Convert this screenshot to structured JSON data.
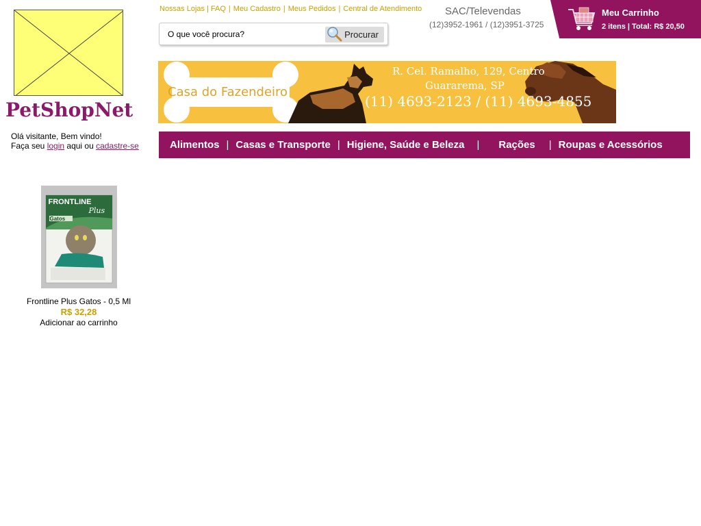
{
  "logo": {
    "text": "PetShopNet"
  },
  "greeting": {
    "line1": "Olá visitante, Bem vindo!",
    "line2_prefix": "Faça seu",
    "login_link": "login",
    "line2_middle": "aqui ou",
    "signup_link": "cadastre-se"
  },
  "top_links": [
    "Nossas Lojas",
    "FAQ",
    "Meu Cadastro",
    "Meus Pedidos",
    "Central de Atendimento"
  ],
  "sac": {
    "title": "SAC/Televendas",
    "phones": "(12)3952-1961 / (12)3951-3725"
  },
  "cart": {
    "title": "Meu Carrinho",
    "info": "2 itens | Total: R$ 20,50",
    "icon": "shopping-cart-icon"
  },
  "search": {
    "placeholder": "O que você procura?",
    "button_label": "Procurar",
    "icon": "magnifier-icon"
  },
  "banner": {
    "name": "Casa do Fazendeiro",
    "address_line1": "R. Cel. Ramalho, 129, Centro",
    "address_line2": "Guararema, SP",
    "phones": "(11) 4693-2123 / (11) 4693-4855"
  },
  "nav": [
    "Alimentos",
    "Casas e Transporte",
    "Higiene, Saúde e Beleza",
    "Rações",
    "Roupas e Acessórios"
  ],
  "product": {
    "name": "Frontline Plus Gatos - 0,5 Ml",
    "price": "R$ 32,28",
    "add_label": "Adicionar ao carrinho",
    "image_text": {
      "brand": "FRONTLINE",
      "sub": "Plus",
      "label": "Gatos"
    }
  },
  "colors": {
    "brand": "#92145f",
    "accent": "#c9a000",
    "banner_bg": "#f7c13f",
    "logo_placeholder": "#ffff77"
  }
}
